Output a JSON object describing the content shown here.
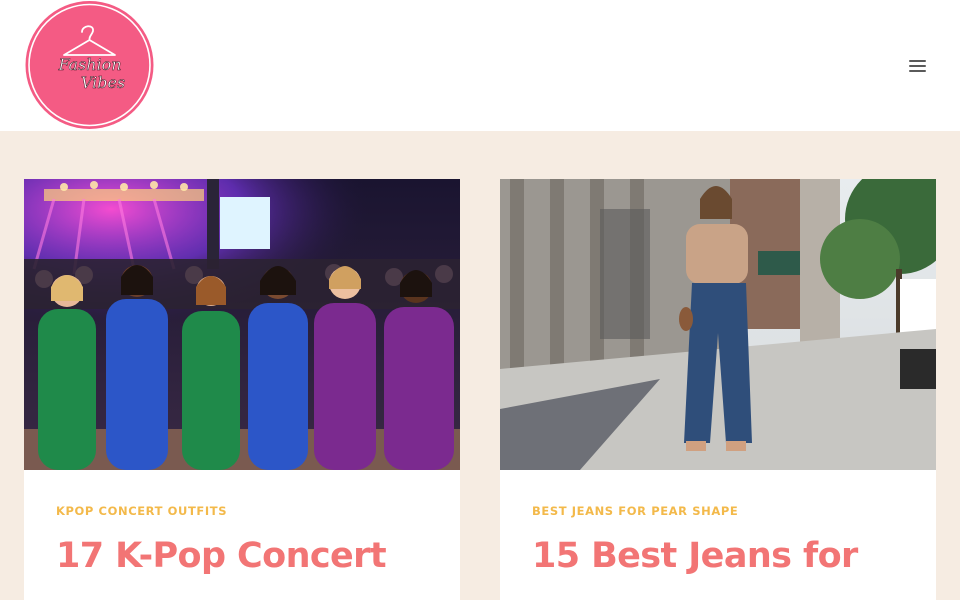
{
  "header": {
    "logo": {
      "line1": "Fashion",
      "line2": "Vibes",
      "badge_color": "#f45b84",
      "icon": "hanger-icon"
    },
    "menu_icon": "hamburger-menu-icon"
  },
  "posts": [
    {
      "category": "KPOP CONCERT OUTFITS",
      "title": "17 K-Pop Concert",
      "image": "photo of six women in matching green, blue and purple sequined jumpsuits at an outdoor concert"
    },
    {
      "category": "BEST JEANS FOR PEAR SHAPE",
      "title": "15 Best Jeans for",
      "image": "photo of a woman in sunglasses, beige top and wide-leg jeans walking on a city sidewalk"
    }
  ],
  "colors": {
    "page_background": "#f6ece2",
    "category": "#f3b94a",
    "title": "#f27575"
  }
}
